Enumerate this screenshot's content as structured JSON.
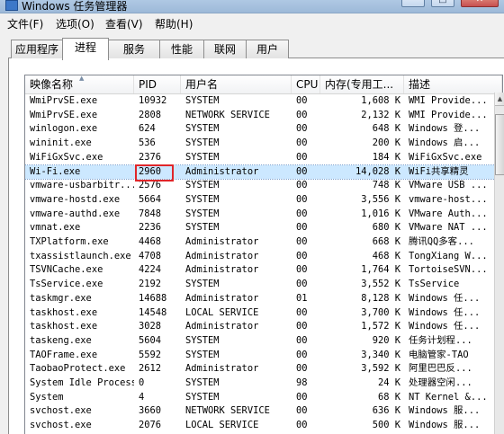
{
  "window": {
    "title": "Windows 任务管理器",
    "buttons": [
      "–",
      "□",
      "✕"
    ]
  },
  "menu": [
    "文件(F)",
    "选项(O)",
    "查看(V)",
    "帮助(H)"
  ],
  "tabs": [
    "应用程序",
    "进程",
    "服务",
    "性能",
    "联网",
    "用户"
  ],
  "active_tab": "进程",
  "columns": [
    "映像名称",
    "PID",
    "用户名",
    "CPU",
    "内存(专用工...",
    "描述"
  ],
  "rows": [
    [
      "WmiPrvSE.exe",
      "10932",
      "SYSTEM",
      "00",
      "1,608 K",
      "WMI Provide..."
    ],
    [
      "WmiPrvSE.exe",
      "2808",
      "NETWORK SERVICE",
      "00",
      "2,132 K",
      "WMI Provide..."
    ],
    [
      "winlogon.exe",
      "624",
      "SYSTEM",
      "00",
      "648 K",
      "Windows 登..."
    ],
    [
      "wininit.exe",
      "536",
      "SYSTEM",
      "00",
      "200 K",
      "Windows 启..."
    ],
    [
      "WiFiGxSvc.exe",
      "2376",
      "SYSTEM",
      "00",
      "184 K",
      "WiFiGxSvc.exe"
    ],
    [
      "Wi-Fi.exe",
      "2960",
      "Administrator",
      "00",
      "14,028 K",
      "WiFi共享精灵"
    ],
    [
      "vmware-usbarbitr...",
      "2576",
      "SYSTEM",
      "00",
      "748 K",
      "VMware USB ..."
    ],
    [
      "vmware-hostd.exe",
      "5664",
      "SYSTEM",
      "00",
      "3,556 K",
      "vmware-host..."
    ],
    [
      "vmware-authd.exe",
      "7848",
      "SYSTEM",
      "00",
      "1,016 K",
      "VMware Auth..."
    ],
    [
      "vmnat.exe",
      "2236",
      "SYSTEM",
      "00",
      "680 K",
      "VMware NAT ..."
    ],
    [
      "TXPlatform.exe",
      "4468",
      "Administrator",
      "00",
      "668 K",
      "腾讯QQ多客..."
    ],
    [
      "txassistlaunch.exe",
      "4708",
      "Administrator",
      "00",
      "468 K",
      "TongXiang W..."
    ],
    [
      "TSVNCache.exe",
      "4224",
      "Administrator",
      "00",
      "1,764 K",
      "TortoiseSVN..."
    ],
    [
      "TsService.exe",
      "2192",
      "SYSTEM",
      "00",
      "3,552 K",
      "TsService"
    ],
    [
      "taskmgr.exe",
      "14688",
      "Administrator",
      "01",
      "8,128 K",
      "Windows 任..."
    ],
    [
      "taskhost.exe",
      "14548",
      "LOCAL SERVICE",
      "00",
      "3,700 K",
      "Windows 任..."
    ],
    [
      "taskhost.exe",
      "3028",
      "Administrator",
      "00",
      "1,572 K",
      "Windows 任..."
    ],
    [
      "taskeng.exe",
      "5604",
      "SYSTEM",
      "00",
      "920 K",
      "任务计划程..."
    ],
    [
      "TAOFrame.exe",
      "5592",
      "SYSTEM",
      "00",
      "3,340 K",
      "电脑管家-TAO"
    ],
    [
      "TaobaoProtect.exe",
      "2612",
      "Administrator",
      "00",
      "3,592 K",
      "阿里巴巴反..."
    ],
    [
      "System Idle Process",
      "0",
      "SYSTEM",
      "98",
      "24 K",
      "处理器空闲..."
    ],
    [
      "System",
      "4",
      "SYSTEM",
      "00",
      "68 K",
      "NT Kernel &..."
    ],
    [
      "svchost.exe",
      "3660",
      "NETWORK SERVICE",
      "00",
      "636 K",
      "Windows 服..."
    ],
    [
      "svchost.exe",
      "2076",
      "LOCAL SERVICE",
      "00",
      "500 K",
      "Windows 服..."
    ]
  ],
  "selected_row": 5,
  "highlighted_value": "2960"
}
